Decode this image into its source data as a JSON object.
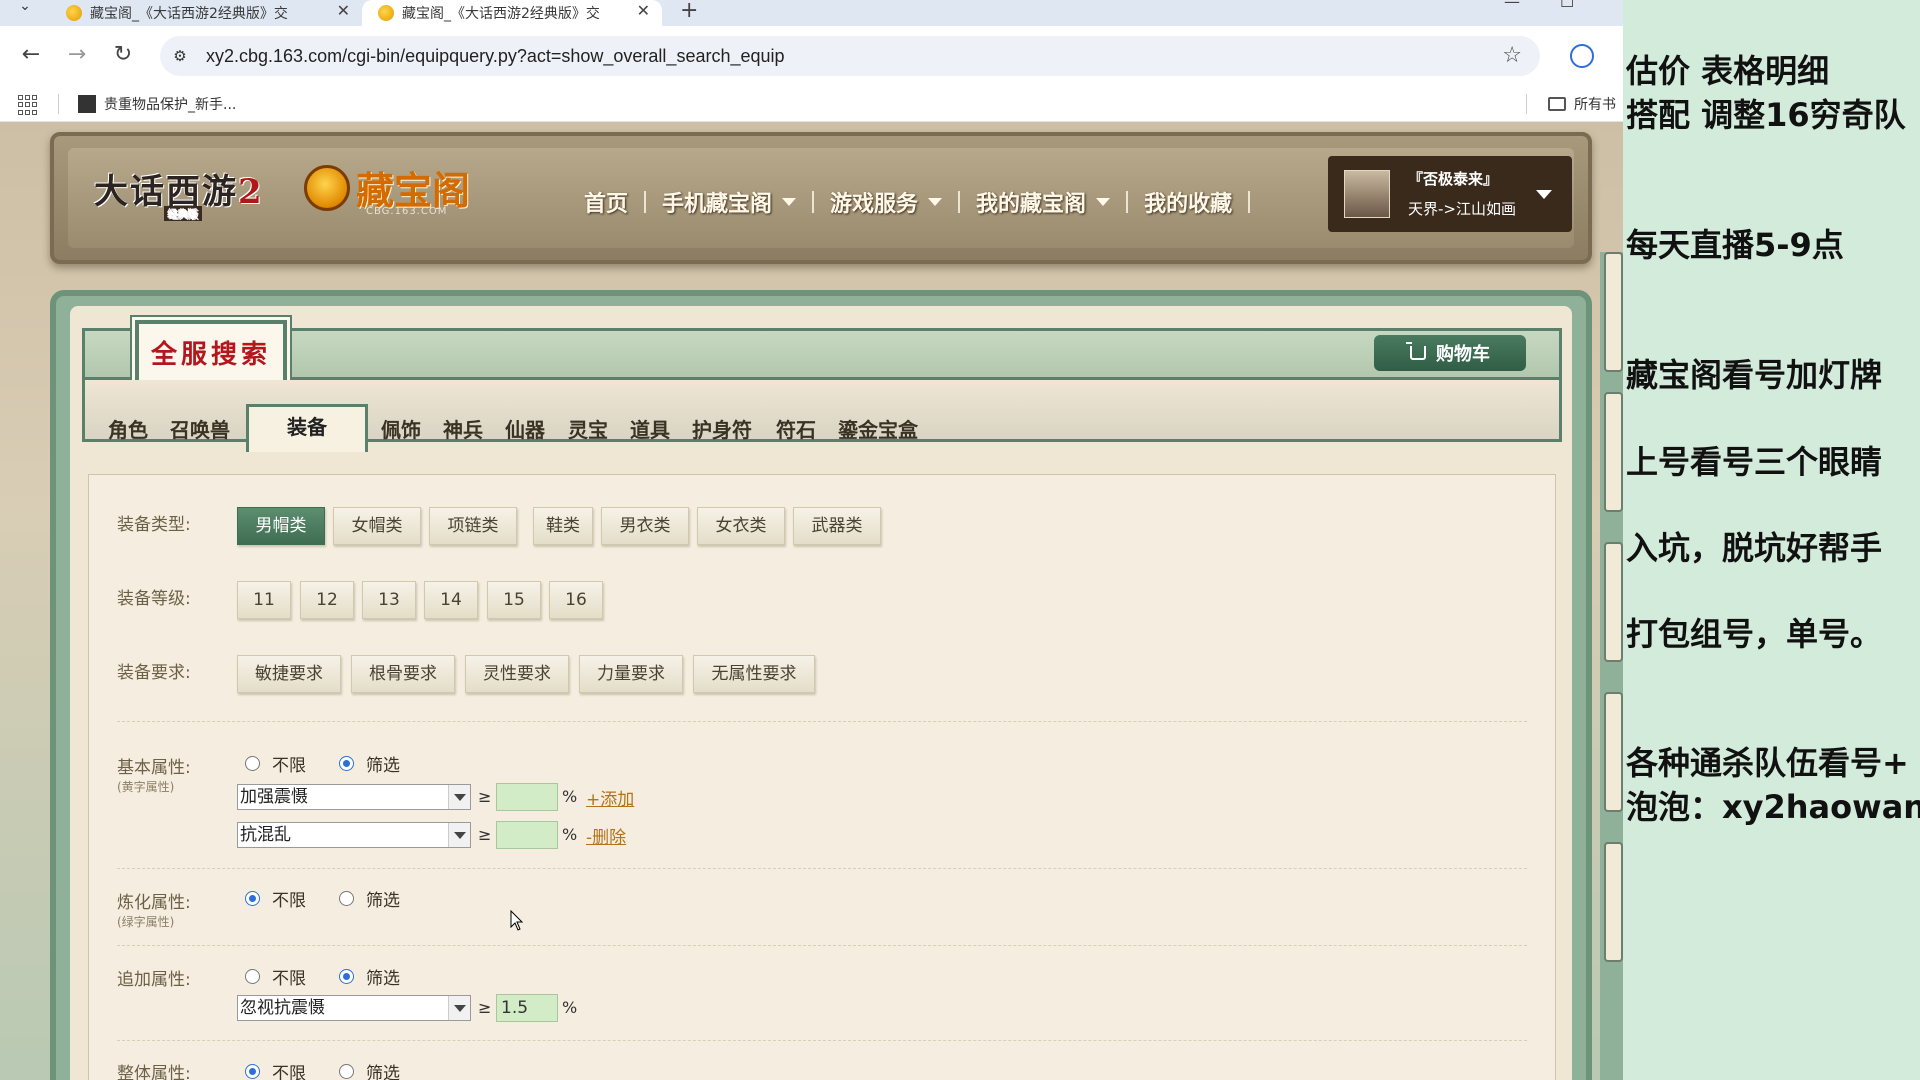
{
  "browser": {
    "tabs": [
      {
        "title": "藏宝阁_《大话西游2经典版》交",
        "active": false
      },
      {
        "title": "藏宝阁_《大话西游2经典版》交",
        "active": true
      }
    ],
    "url": "xy2.cbg.163.com/cgi-bin/equipquery.py?act=show_overall_search_equip",
    "bookmarks": [
      {
        "label": "贵重物品保护_新手..."
      }
    ],
    "bookmark_folder": "所有书"
  },
  "header": {
    "game_logo": "大话西游",
    "game_logo_num": "2",
    "game_logo_sub": "经典版",
    "cbg_logo": "藏宝阁",
    "cbg_domain": "CBG.163.COM",
    "nav": [
      {
        "label": "首页",
        "dropdown": false
      },
      {
        "label": "手机藏宝阁",
        "dropdown": true
      },
      {
        "label": "游戏服务",
        "dropdown": true
      },
      {
        "label": "我的藏宝阁",
        "dropdown": true
      },
      {
        "label": "我的收藏",
        "dropdown": false
      }
    ],
    "user": {
      "name": "『否极泰来』",
      "server": "天界->江山如画"
    }
  },
  "panel": {
    "title": "全服搜索",
    "cart_label": "购物车",
    "categories": [
      "角色",
      "召唤兽",
      "装备",
      "佩饰",
      "神兵",
      "仙器",
      "灵宝",
      "道具",
      "护身符",
      "符石",
      "鎏金宝盒"
    ],
    "active_category": "装备"
  },
  "filters": {
    "equip_type": {
      "label": "装备类型:",
      "options": [
        "男帽类",
        "女帽类",
        "项链类",
        "鞋类",
        "男衣类",
        "女衣类",
        "武器类"
      ],
      "selected": "男帽类"
    },
    "equip_level": {
      "label": "装备等级:",
      "options": [
        "11",
        "12",
        "13",
        "14",
        "15",
        "16"
      ]
    },
    "equip_req": {
      "label": "装备要求:",
      "options": [
        "敏捷要求",
        "根骨要求",
        "灵性要求",
        "力量要求",
        "无属性要求"
      ]
    },
    "basic_attr": {
      "label": "基本属性:",
      "sub": "(黄字属性)",
      "radio_any": "不限",
      "radio_filter": "筛选",
      "selected": "筛选",
      "rows": [
        {
          "select": "加强震慑",
          "ge": "≥",
          "value": "",
          "unit": "%",
          "action": "+添加"
        },
        {
          "select": "抗混乱",
          "ge": "≥",
          "value": "",
          "unit": "%",
          "action": "-删除"
        }
      ]
    },
    "refine_attr": {
      "label": "炼化属性:",
      "sub": "(绿字属性)",
      "radio_any": "不限",
      "radio_filter": "筛选",
      "selected": "不限"
    },
    "extra_attr": {
      "label": "追加属性:",
      "radio_any": "不限",
      "radio_filter": "筛选",
      "selected": "筛选",
      "row": {
        "select": "忽视抗震慑",
        "ge": "≥",
        "value": "1.5",
        "unit": "%"
      }
    },
    "overall_attr": {
      "label": "整体属性:",
      "radio_any": "不限",
      "radio_filter": "筛选",
      "selected": "不限"
    }
  },
  "overlay": {
    "lines": [
      "估价  表格明细",
      "搭配 调整16穷奇队",
      "每天直播5-9点",
      "藏宝阁看号加灯牌",
      "上号看号三个眼睛",
      "入坑，脱坑好帮手",
      "打包组号，单号。",
      "各种通杀队伍看号+",
      "泡泡：xy2haowan"
    ]
  }
}
